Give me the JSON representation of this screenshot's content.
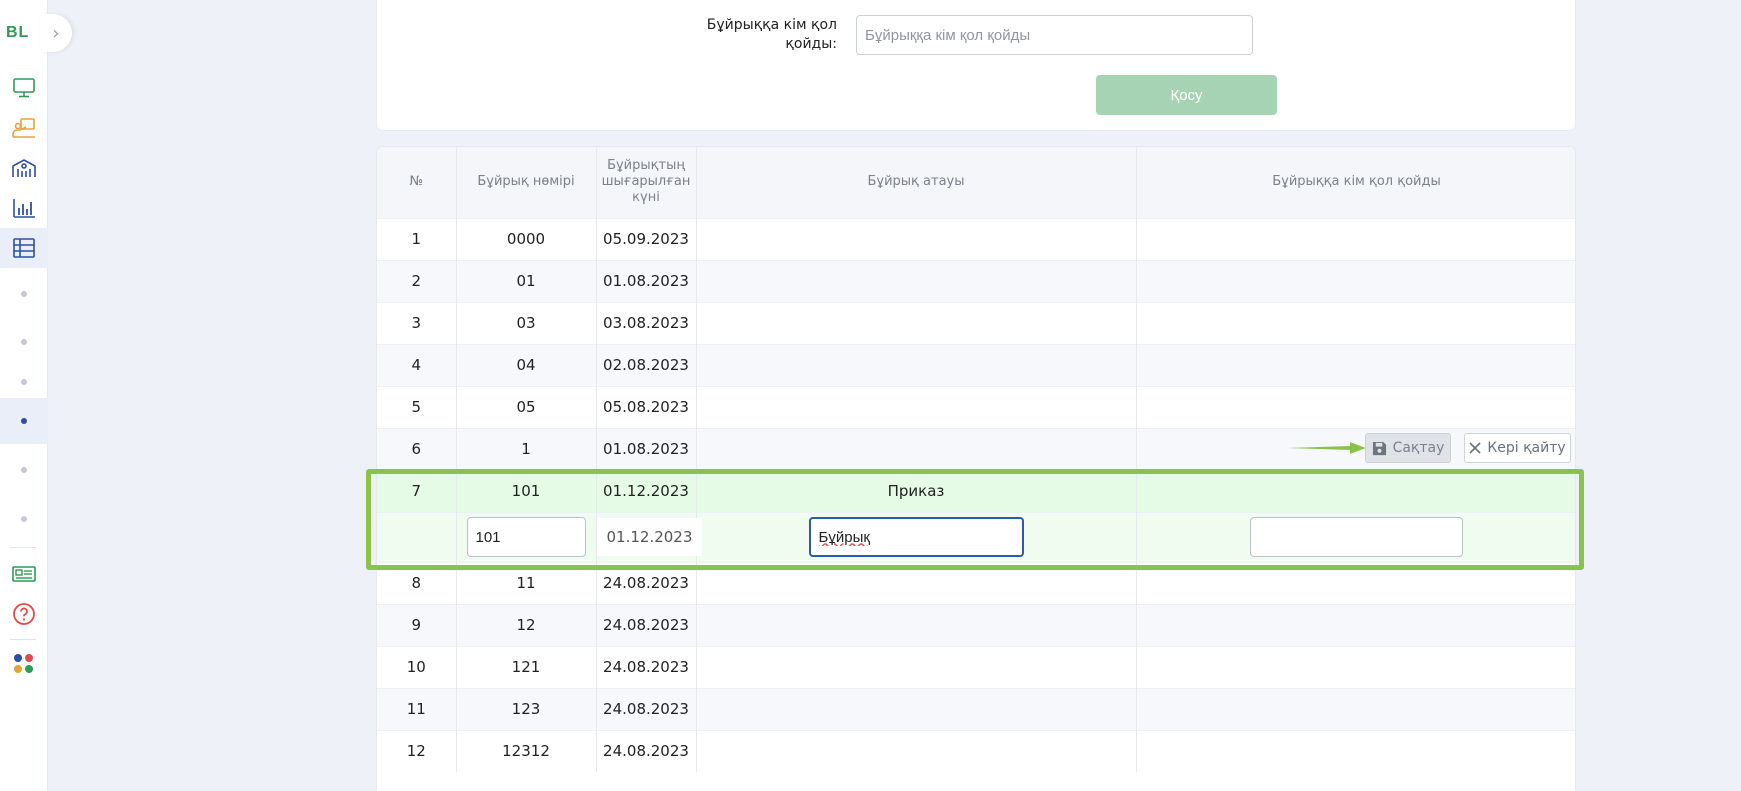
{
  "sidebar": {
    "logo": "BL",
    "expand_glyph": "›",
    "colors": {
      "green": "#2e9b55",
      "orange": "#e8a23a",
      "blue": "#2d4fa3",
      "red": "#e24b4b"
    }
  },
  "form": {
    "signer_label": "Бұйрыққа кім қол қойды:",
    "signer_placeholder": "Бұйрыққа кім қол қойды",
    "add_button": "Қосу"
  },
  "table": {
    "headers": [
      "№",
      "Бұйрық нөмірі",
      "Бұйрықтың шығарылған күні",
      "Бұйрық атауы",
      "Бұйрыққа кім қол қойды"
    ],
    "rows": [
      {
        "n": "1",
        "number": "0000",
        "date": "05.09.2023",
        "name": "",
        "signer": ""
      },
      {
        "n": "2",
        "number": "01",
        "date": "01.08.2023",
        "name": "",
        "signer": ""
      },
      {
        "n": "3",
        "number": "03",
        "date": "03.08.2023",
        "name": "",
        "signer": ""
      },
      {
        "n": "4",
        "number": "04",
        "date": "02.08.2023",
        "name": "",
        "signer": ""
      },
      {
        "n": "5",
        "number": "05",
        "date": "05.08.2023",
        "name": "",
        "signer": ""
      },
      {
        "n": "6",
        "number": "1",
        "date": "01.08.2023",
        "name": "",
        "signer": ""
      },
      {
        "n": "7",
        "number": "101",
        "date": "01.12.2023",
        "name": "Приказ",
        "signer": ""
      },
      {
        "n": "8",
        "number": "11",
        "date": "24.08.2023",
        "name": "",
        "signer": ""
      },
      {
        "n": "9",
        "number": "12",
        "date": "24.08.2023",
        "name": "",
        "signer": ""
      },
      {
        "n": "10",
        "number": "121",
        "date": "24.08.2023",
        "name": "",
        "signer": ""
      },
      {
        "n": "11",
        "number": "123",
        "date": "24.08.2023",
        "name": "",
        "signer": ""
      },
      {
        "n": "12",
        "number": "12312",
        "date": "24.08.2023",
        "name": "",
        "signer": ""
      }
    ],
    "edit_row": {
      "number": "101",
      "date": "01.12.2023",
      "name": "Бұйрық",
      "signer": ""
    },
    "save_button": "Сақтау",
    "cancel_button": "Кері қайту",
    "highlight_color": "#8bc34a"
  }
}
